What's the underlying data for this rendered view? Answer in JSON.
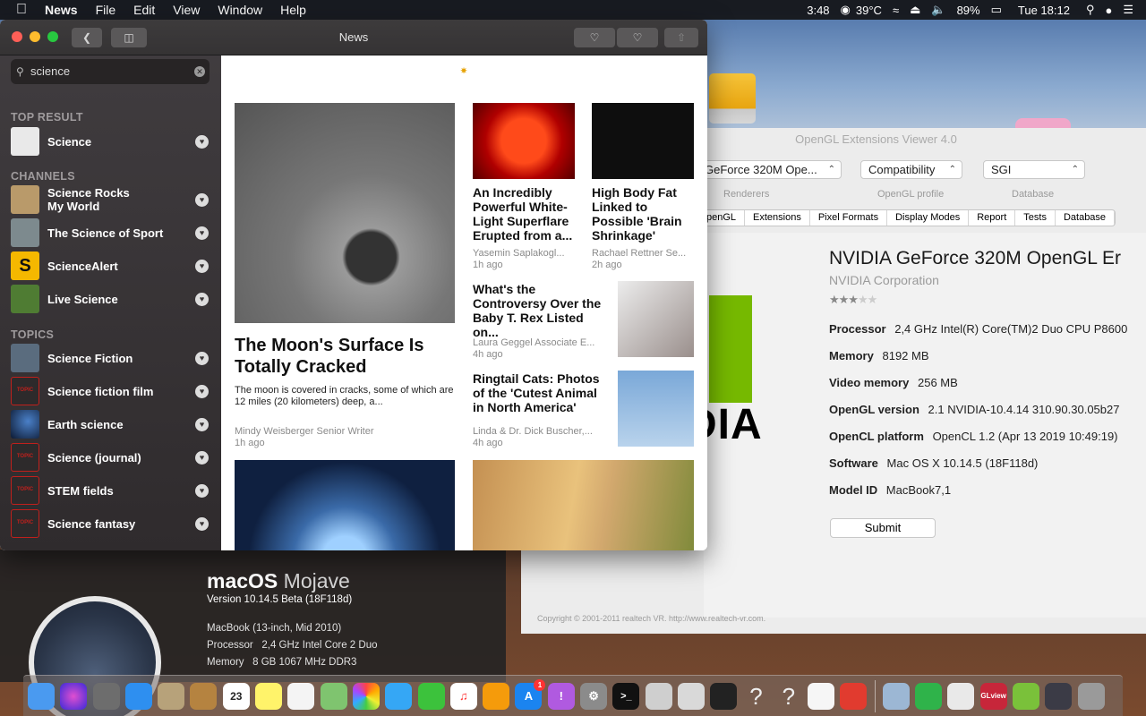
{
  "menubar": {
    "app": "News",
    "items": [
      "File",
      "Edit",
      "View",
      "Window",
      "Help"
    ],
    "status": {
      "time_small": "3:48",
      "temp": "39°C",
      "battery": "89%",
      "clock": "Tue 18:12"
    }
  },
  "news_window": {
    "title": "News",
    "search": {
      "value": "science"
    },
    "sections": {
      "top": "TOP RESULT",
      "channels": "CHANNELS",
      "topics": "TOPICS"
    },
    "top_result": "Science",
    "channels": [
      "Science Rocks\nMy World",
      "The Science of Sport",
      "ScienceAlert",
      "Live Science"
    ],
    "topics": [
      "Science Fiction",
      "Science fiction film",
      "Earth science",
      "Science (journal)",
      "STEM fields",
      "Science fantasy"
    ],
    "topic_badge": "TOPIC",
    "articles": [
      {
        "title": "The Moon's Surface Is Totally Cracked",
        "summary": "The moon is covered in cracks, some of which are 12 miles (20 kilometers) deep, a...",
        "author": "Mindy Weisberger Senior Writer",
        "age": "1h ago"
      },
      {
        "title": "An Incredibly Powerful White-Light Superflare Erupted from a...",
        "author": "Yasemin Saplakogl...",
        "age": "1h ago"
      },
      {
        "title": "High Body Fat Linked to Possible 'Brain Shrinkage'",
        "author": "Rachael Rettner Se...",
        "age": "2h ago"
      },
      {
        "title": "What's the Controversy Over the Baby T. Rex Listed on...",
        "author": "Laura Geggel Associate E...",
        "age": "4h ago"
      },
      {
        "title": "Ringtail Cats: Photos of the 'Cutest Animal in North America'",
        "author": "Linda & Dr. Dick Buscher,...",
        "age": "4h ago"
      }
    ]
  },
  "opengl": {
    "title": "OpenGL Extensions Viewer 4.0",
    "renderer": "GeForce 320M Ope...",
    "profile": "Compatibility",
    "database": "SGI",
    "captions": [
      "Renderers",
      "OpenGL profile",
      "Database"
    ],
    "tabs": [
      "penGL",
      "Extensions",
      "Pixel Formats",
      "Display Modes",
      "Report",
      "Tests",
      "Database"
    ],
    "gpu": "NVIDIA GeForce 320M OpenGL Er",
    "vendor": "NVIDIA Corporation",
    "rating": 3,
    "rating_max": 5,
    "logo_text": "DIA",
    "specs": [
      {
        "label": "Processor",
        "value": "2,4 GHz Intel(R) Core(TM)2 Duo CPU     P8600"
      },
      {
        "label": "Memory",
        "value": "8192 MB"
      },
      {
        "label": "Video memory",
        "value": "256 MB"
      },
      {
        "label": "OpenGL version",
        "value": "2.1 NVIDIA-10.4.14 310.90.30.05b27"
      },
      {
        "label": "OpenCL platform",
        "value": "OpenCL 1.2 (Apr 13 2019 10:49:19)"
      },
      {
        "label": "Software",
        "value": "Mac OS X 10.14.5 (18F118d)"
      },
      {
        "label": "Model ID",
        "value": "MacBook7,1"
      }
    ],
    "submit": "Submit",
    "copyright": "Copyright © 2001-2011 realtech VR. http://www.realtech-vr.com."
  },
  "about": {
    "os_bold": "macOS",
    "os_name": "Mojave",
    "version": "Version 10.14.5 Beta (18F118d)",
    "model": "MacBook (13-inch, Mid 2010)",
    "processor_label": "Processor",
    "processor": "2,4 GHz Intel Core 2 Duo",
    "memory_label": "Memory",
    "memory": "8 GB 1067 MHz DDR3"
  },
  "dock": {
    "calendar_day": "23",
    "appstore_badge": "1",
    "glview": "GLview",
    "question": "?"
  }
}
